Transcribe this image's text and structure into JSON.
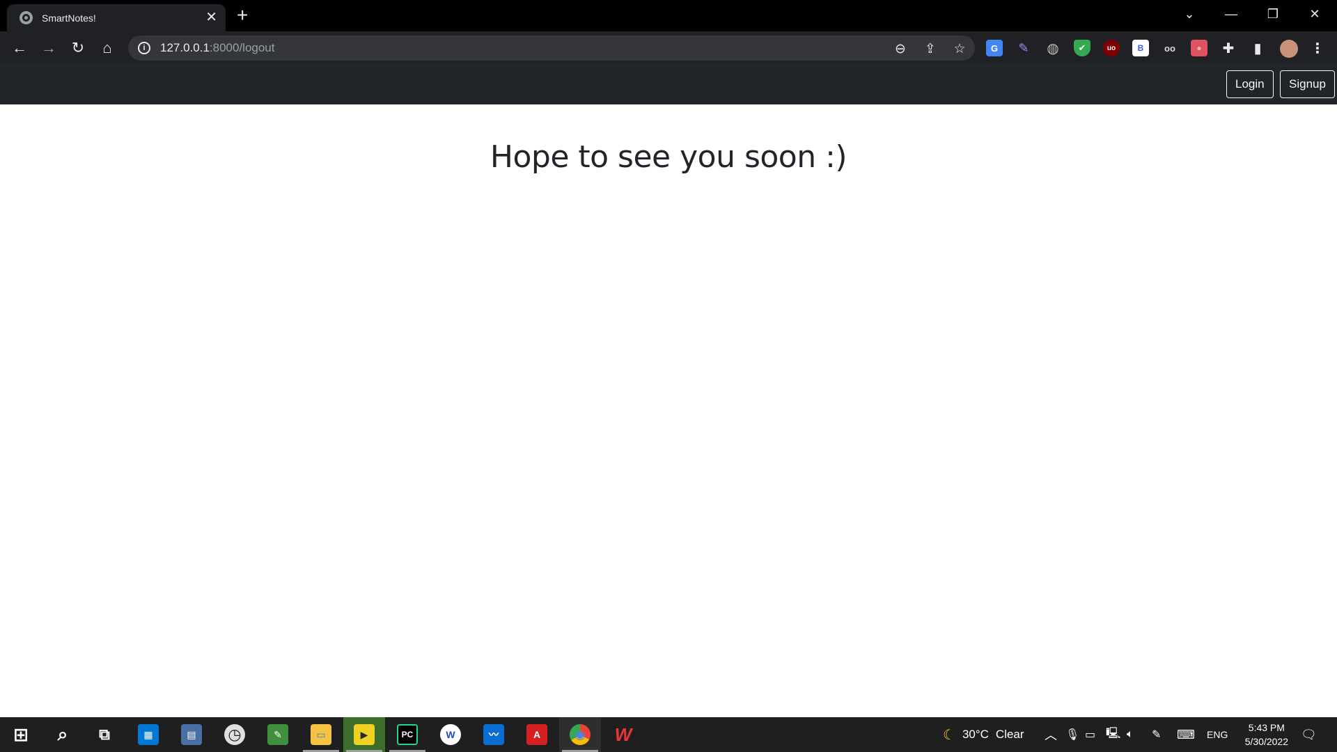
{
  "browser": {
    "tab_title": "SmartNotes!",
    "tab_close": "✕",
    "new_tab": "+",
    "url_host": "127.0.0.1",
    "url_rest": ":8000/logout",
    "window_controls": {
      "minimize": "—",
      "restore": "❐",
      "close": "✕",
      "tab_search": "⌄"
    }
  },
  "toolbar_icons": {
    "back": "←",
    "forward": "→",
    "reload": "↻",
    "home": "⌂",
    "zoom": "⊖",
    "share": "⇪",
    "bookmark": "☆",
    "profile_menu": "⋮"
  },
  "extensions": [
    {
      "name": "translate-extension-icon",
      "glyph": "G",
      "color": "#4285f4"
    },
    {
      "name": "feather-extension-icon",
      "glyph": "✎",
      "color": "#a78bfa"
    },
    {
      "name": "globe-extension-icon",
      "glyph": "◍",
      "color": "#bdbdbd"
    },
    {
      "name": "shield-extension-icon",
      "glyph": "✔",
      "color": "#34a853"
    },
    {
      "name": "ublock-extension-icon",
      "glyph": "uo",
      "color": "#800000"
    },
    {
      "name": "b-extension-icon",
      "glyph": "B",
      "color": "#ffffff"
    },
    {
      "name": "glasses-extension-icon",
      "glyph": "oo",
      "color": "#dddddd"
    },
    {
      "name": "recorder-extension-icon",
      "glyph": "●",
      "color": "#e05260"
    },
    {
      "name": "puzzle-extensions-icon",
      "glyph": "✚",
      "color": "#e8eaed"
    },
    {
      "name": "side-panel-icon",
      "glyph": "▮",
      "color": "#e8eaed"
    }
  ],
  "site_nav": {
    "login_label": "Login",
    "signup_label": "Signup"
  },
  "main": {
    "heading": "Hope to see you soon :)"
  },
  "taskbar": {
    "apps": [
      {
        "name": "start-button",
        "glyph": "⊞",
        "color": "transparent"
      },
      {
        "name": "search-taskbar-icon",
        "glyph": "⌕",
        "color": "transparent"
      },
      {
        "name": "task-view-icon",
        "glyph": "⧉",
        "color": "transparent"
      },
      {
        "name": "store-app-icon",
        "glyph": "▦",
        "color": "#0078d4"
      },
      {
        "name": "calculator-app-icon",
        "glyph": "▤",
        "color": "#4a6fa5"
      },
      {
        "name": "clock-app-icon",
        "glyph": "◷",
        "color": "#e0e0e0"
      },
      {
        "name": "editor-app-icon",
        "glyph": "✎",
        "color": "#3f8f3f"
      },
      {
        "name": "file-explorer-icon",
        "glyph": "▭",
        "color": "#f5c242"
      },
      {
        "name": "player-app-icon",
        "glyph": "▶",
        "color": "#f0d020"
      },
      {
        "name": "pycharm-app-icon",
        "glyph": "PC",
        "color": "#000000"
      },
      {
        "name": "app-w-icon",
        "glyph": "W",
        "color": "#ffffff"
      },
      {
        "name": "whiteboard-app-icon",
        "glyph": "〰",
        "color": "#0a6ed1"
      },
      {
        "name": "acrobat-app-icon",
        "glyph": "A",
        "color": "#d32020"
      },
      {
        "name": "chrome-app-icon",
        "glyph": "◉",
        "color": "#34a853"
      },
      {
        "name": "wps-app-icon",
        "glyph": "W",
        "color": "#e53935"
      }
    ],
    "weather_temp": "30°C",
    "weather_desc": "Clear",
    "language": "ENG",
    "time": "5:43 PM",
    "date": "5/30/2022"
  }
}
